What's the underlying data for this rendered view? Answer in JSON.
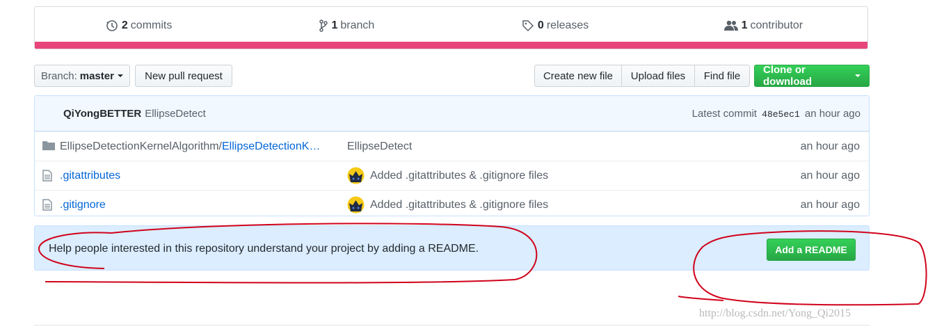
{
  "summary": {
    "commits_count": "2",
    "commits_label": "commits",
    "branches_count": "1",
    "branches_label": "branch",
    "releases_count": "0",
    "releases_label": "releases",
    "contributors_count": "1",
    "contributors_label": "contributor",
    "language_bar_color": "#e8457a"
  },
  "toolbar": {
    "branch_prefix": "Branch:",
    "branch_name": "master",
    "new_pull_request": "New pull request",
    "create_new_file": "Create new file",
    "upload_files": "Upload files",
    "find_file": "Find file",
    "clone_or_download": "Clone or download"
  },
  "commit_tease": {
    "author": "QiYongBETTER",
    "message": "EllipseDetect",
    "latest_label": "Latest commit",
    "sha": "48e5ec1",
    "age": "an hour ago"
  },
  "files": [
    {
      "type": "folder",
      "name_prefix": "EllipseDetectionKernelAlgorithm/",
      "name": "EllipseDetectionK…",
      "commit_message": "EllipseDetect",
      "age": "an hour ago"
    },
    {
      "type": "file",
      "name": ".gitattributes",
      "commit_message": "Added .gitattributes & .gitignore files",
      "age": "an hour ago"
    },
    {
      "type": "file",
      "name": ".gitignore",
      "commit_message": "Added .gitattributes & .gitignore files",
      "age": "an hour ago"
    }
  ],
  "readme_prompt": {
    "text": "Help people interested in this repository understand your project by adding a README.",
    "button_label": "Add a README"
  },
  "watermark": "http://blog.csdn.net/Yong_Qi2015",
  "colors": {
    "accent_green": "#28a745",
    "link_blue": "#0366d6",
    "annotation_red": "#d0021b"
  }
}
